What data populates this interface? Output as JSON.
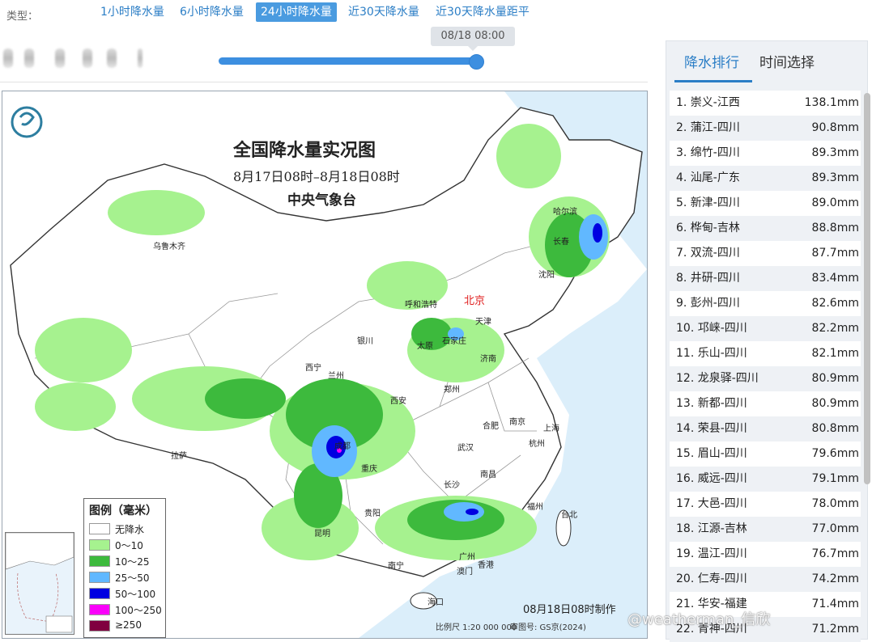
{
  "type_bar": {
    "label": "类型：",
    "tabs": [
      {
        "label": "1小时降水量",
        "active": false
      },
      {
        "label": "6小时降水量",
        "active": false
      },
      {
        "label": "24小时降水量",
        "active": true
      },
      {
        "label": "近30天降水量",
        "active": false
      },
      {
        "label": "近30天降水量距平",
        "active": false
      }
    ]
  },
  "time": {
    "tooltip": "08/18 08:00",
    "slider_position": 1.0
  },
  "map": {
    "title": "全国降水量实况图",
    "subtitle": "8月17日08时–8月18日08时",
    "org": "中央气象台",
    "cities": {
      "urumqi": "乌鲁木齐",
      "harbin": "哈尔滨",
      "changchun": "长春",
      "shenyang": "沈阳",
      "hohhot": "呼和浩特",
      "beijing": "北京",
      "tianjin": "天津",
      "shijiazhuang": "石家庄",
      "taiyuan": "太原",
      "jinan": "济南",
      "yinchuan": "银川",
      "xining": "西宁",
      "lanzhou": "兰州",
      "xian": "西安",
      "zhengzhou": "郑州",
      "hefei": "合肥",
      "nanjing": "南京",
      "shanghai": "上海",
      "wuhan": "武汉",
      "hangzhou": "杭州",
      "lhasa": "拉萨",
      "chengdu": "成都",
      "chongqing": "重庆",
      "changsha": "长沙",
      "nanchang": "南昌",
      "fuzhou": "福州",
      "taibei": "台北",
      "guiyang": "贵阳",
      "kunming": "昆明",
      "nanning": "南宁",
      "guangzhou": "广州",
      "hongkong": "香港",
      "macau": "澳门",
      "haikou": "海口"
    },
    "legend": {
      "title": "图例（毫米）",
      "items": [
        {
          "label": "无降水",
          "color": "#ffffff"
        },
        {
          "label": "0～10",
          "color": "#a6f28f"
        },
        {
          "label": "10～25",
          "color": "#3dba3d"
        },
        {
          "label": "25～50",
          "color": "#61b8ff"
        },
        {
          "label": "50～100",
          "color": "#0000e1"
        },
        {
          "label": "100～250",
          "color": "#fa00fa"
        },
        {
          "label": "≥250",
          "color": "#800040"
        }
      ]
    },
    "made_time": "08月18日08时制作",
    "scale_text": "比例尺 1:20 000 000",
    "review_no": "审图号: GS京(2024)"
  },
  "panel": {
    "tabs": [
      "降水排行",
      "时间选择"
    ],
    "active_tab": 0,
    "ranking": [
      {
        "name": "1. 崇义-江西",
        "value": "138.1mm"
      },
      {
        "name": "2. 蒲江-四川",
        "value": "90.8mm"
      },
      {
        "name": "3. 绵竹-四川",
        "value": "89.3mm"
      },
      {
        "name": "4. 汕尾-广东",
        "value": "89.3mm"
      },
      {
        "name": "5. 新津-四川",
        "value": "89.0mm"
      },
      {
        "name": "6. 桦甸-吉林",
        "value": "88.8mm"
      },
      {
        "name": "7. 双流-四川",
        "value": "87.7mm"
      },
      {
        "name": "8. 井研-四川",
        "value": "83.4mm"
      },
      {
        "name": "9. 彭州-四川",
        "value": "82.6mm"
      },
      {
        "name": "10. 邛崃-四川",
        "value": "82.2mm"
      },
      {
        "name": "11. 乐山-四川",
        "value": "82.1mm"
      },
      {
        "name": "12. 龙泉驿-四川",
        "value": "80.9mm"
      },
      {
        "name": "13. 新都-四川",
        "value": "80.9mm"
      },
      {
        "name": "14. 荣县-四川",
        "value": "80.8mm"
      },
      {
        "name": "15. 眉山-四川",
        "value": "79.6mm"
      },
      {
        "name": "16. 威远-四川",
        "value": "79.1mm"
      },
      {
        "name": "17. 大邑-四川",
        "value": "78.0mm"
      },
      {
        "name": "18. 江源-吉林",
        "value": "77.0mm"
      },
      {
        "name": "19. 温江-四川",
        "value": "76.7mm"
      },
      {
        "name": "20. 仁寿-四川",
        "value": "74.2mm"
      },
      {
        "name": "21. 华安-福建",
        "value": "71.4mm"
      },
      {
        "name": "22. 青神-四川",
        "value": "71.2mm"
      }
    ]
  },
  "watermark": "@weatherman_信欣"
}
